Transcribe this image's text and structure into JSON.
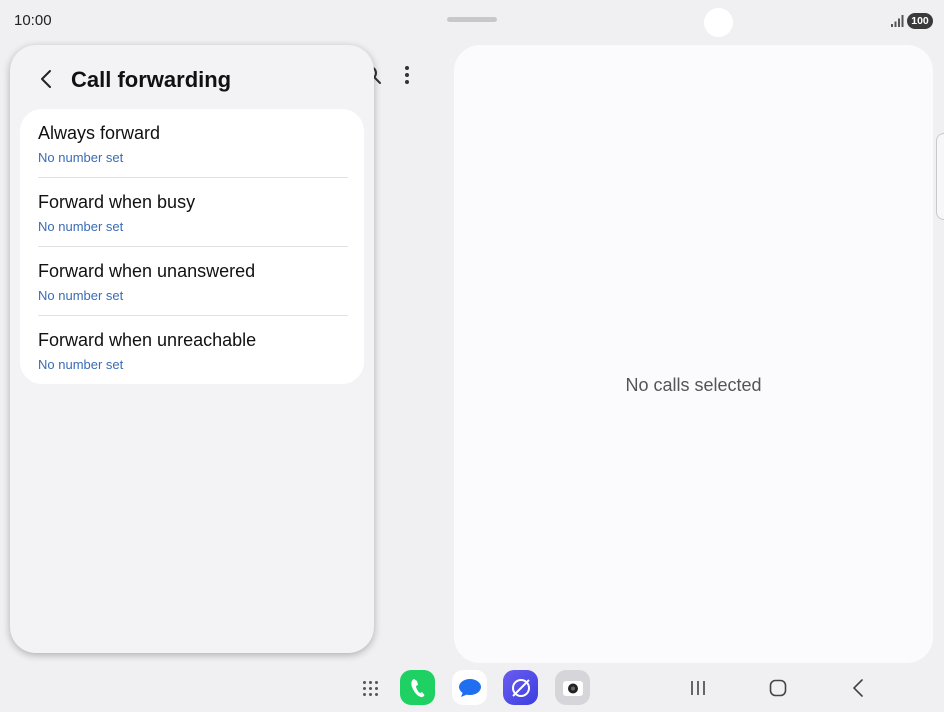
{
  "status_bar": {
    "time": "10:00",
    "battery": "100",
    "signal_icon": "signal-icon"
  },
  "popup": {
    "title": "Call forwarding",
    "back_icon": "back-arrow-icon",
    "items": [
      {
        "label": "Always forward",
        "sub": "No number set"
      },
      {
        "label": "Forward when busy",
        "sub": "No number set"
      },
      {
        "label": "Forward when unanswered",
        "sub": "No number set"
      },
      {
        "label": "Forward when unreachable",
        "sub": "No number set"
      }
    ]
  },
  "right_pane": {
    "empty_text": "No calls selected"
  },
  "taskbar": {
    "apps": [
      "apps-grid-icon",
      "phone-app-icon",
      "messages-app-icon",
      "internet-app-icon",
      "camera-app-icon"
    ],
    "nav": [
      "recents-icon",
      "home-icon",
      "back-icon"
    ]
  },
  "colors": {
    "accent_sub": "#3a6cb5",
    "phone_green": "#1ed162",
    "internet_purple": "#5b4fe8"
  }
}
